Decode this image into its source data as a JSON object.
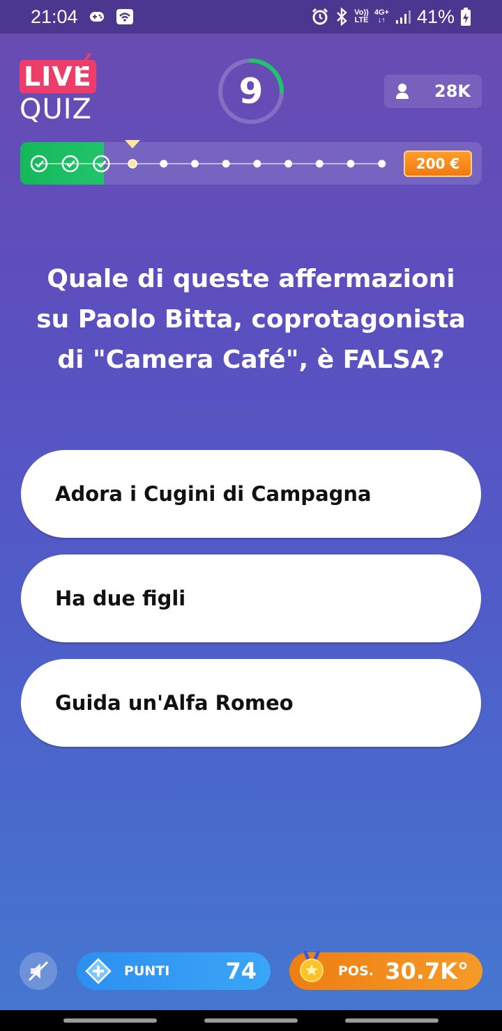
{
  "status_bar": {
    "time": "21:04",
    "battery": "41%",
    "network_top": "Vo))",
    "network_bottom": "LTE",
    "data_top": "4G+",
    "data_bottom": "↓↑",
    "icons": [
      "gamepad-icon",
      "wifi-icon",
      "alarm-icon",
      "bluetooth-icon",
      "signal-icon",
      "battery-charging-icon"
    ]
  },
  "logo": {
    "live": "LIVE",
    "quiz": "QUIZ"
  },
  "timer": {
    "seconds": "9",
    "remaining_fraction": 0.25,
    "accent": "#21c46a"
  },
  "viewers": {
    "count": "28K"
  },
  "progress": {
    "total_steps": 12,
    "completed_steps": 3,
    "current_step": 4,
    "prize": "200 €"
  },
  "question": {
    "text": "Quale di queste affermazioni su Paolo Bitta, coprotagonista di \"Camera Café\", è FALSA?"
  },
  "answers": [
    {
      "label": "Adora i Cugini di Campagna"
    },
    {
      "label": "Ha due figli"
    },
    {
      "label": "Guida un'Alfa Romeo"
    }
  ],
  "bottom_bar": {
    "points_label": "PUNTI",
    "points_value": "74",
    "position_label": "POS.",
    "position_value": "30.7K°"
  }
}
